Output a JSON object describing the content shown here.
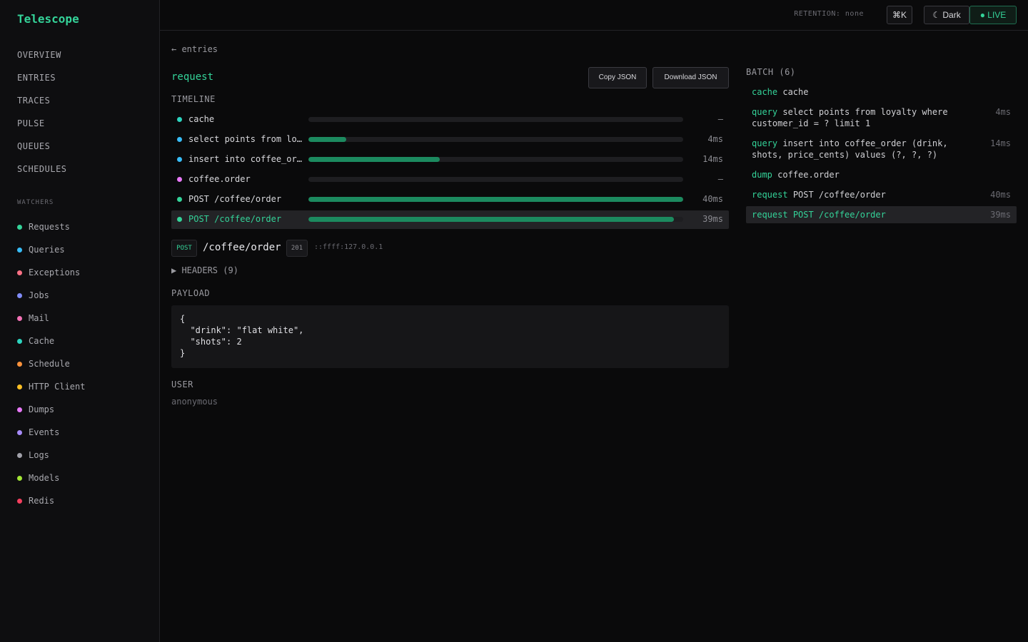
{
  "app": {
    "title": "Telescope"
  },
  "nav": {
    "items": [
      "OVERVIEW",
      "ENTRIES",
      "TRACES",
      "PULSE",
      "QUEUES",
      "SCHEDULES"
    ],
    "watchers_heading": "WATCHERS",
    "watchers": [
      {
        "label": "Requests",
        "color": "#34d399"
      },
      {
        "label": "Queries",
        "color": "#38bdf8"
      },
      {
        "label": "Exceptions",
        "color": "#fb7185"
      },
      {
        "label": "Jobs",
        "color": "#818cf8"
      },
      {
        "label": "Mail",
        "color": "#f472b6"
      },
      {
        "label": "Cache",
        "color": "#2dd4bf"
      },
      {
        "label": "Schedule",
        "color": "#fb923c"
      },
      {
        "label": "HTTP Client",
        "color": "#fbbf24"
      },
      {
        "label": "Dumps",
        "color": "#e879f9"
      },
      {
        "label": "Events",
        "color": "#a78bfa"
      },
      {
        "label": "Logs",
        "color": "#a1a1aa"
      },
      {
        "label": "Models",
        "color": "#a3e635"
      },
      {
        "label": "Redis",
        "color": "#f43f5e"
      }
    ]
  },
  "topbar": {
    "retention": "RETENTION: none",
    "shortcut": "⌘K",
    "theme": "☾ Dark",
    "live": "● LIVE"
  },
  "detail": {
    "back": "← entries",
    "title": "request",
    "copy_label": "Copy JSON",
    "download_label": "Download JSON",
    "timeline_heading": "TIMELINE",
    "timeline": [
      {
        "label": "cache",
        "duration": "—",
        "fill": 0,
        "color": "#2dd4bf",
        "active": false
      },
      {
        "label": "select points from loyalty where customer_id = ? limit 1",
        "duration": "4ms",
        "fill": 0.1,
        "color": "#38bdf8",
        "active": false
      },
      {
        "label": "insert into coffee_order (drink, shots, price_cents) values (?, ?, ?)",
        "duration": "14ms",
        "fill": 0.35,
        "color": "#38bdf8",
        "active": false
      },
      {
        "label": "coffee.order",
        "duration": "—",
        "fill": 0,
        "color": "#e879f9",
        "active": false
      },
      {
        "label": "POST /coffee/order",
        "duration": "40ms",
        "fill": 1.0,
        "color": "#34d399",
        "active": false
      },
      {
        "label": "POST /coffee/order",
        "duration": "39ms",
        "fill": 0.975,
        "color": "#34d399",
        "active": true
      }
    ],
    "method": "POST",
    "path": "/coffee/order",
    "status": "201",
    "ip": "::ffff:127.0.0.1",
    "headers_toggle": "▶ HEADERS (9)",
    "payload_heading": "PAYLOAD",
    "payload": "{\n  \"drink\": \"flat white\",\n  \"shots\": 2\n}",
    "user_heading": "USER",
    "user": "anonymous"
  },
  "batch": {
    "title": "BATCH (6)",
    "items": [
      {
        "type": "cache",
        "label": "cache",
        "duration": "",
        "active": false
      },
      {
        "type": "query",
        "label": "select points from loyalty where customer_id = ? limit 1",
        "duration": "4ms",
        "active": false
      },
      {
        "type": "query",
        "label": "insert into coffee_order (drink, shots, price_cents) values (?, ?, ?)",
        "duration": "14ms",
        "active": false
      },
      {
        "type": "dump",
        "label": "coffee.order",
        "duration": "",
        "active": false
      },
      {
        "type": "request",
        "label": "POST /coffee/order",
        "duration": "40ms",
        "active": false
      },
      {
        "type": "request",
        "label": "POST /coffee/order",
        "duration": "39ms",
        "active": true
      }
    ]
  }
}
